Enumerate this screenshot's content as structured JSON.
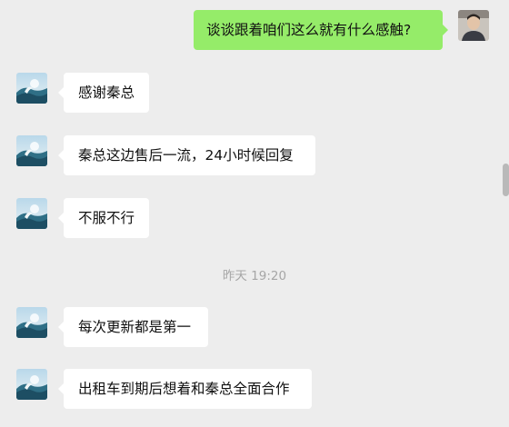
{
  "chat": {
    "sent": {
      "text": "谈谈跟着咱们这么就有什么感触?",
      "avatar_icon": "user-photo-avatar"
    },
    "received": [
      {
        "text": "感谢秦总",
        "avatar_icon": "ocean-wave-avatar"
      },
      {
        "text": "秦总这边售后一流，24小时候回复",
        "avatar_icon": "ocean-wave-avatar"
      },
      {
        "text": "不服不行",
        "avatar_icon": "ocean-wave-avatar"
      }
    ],
    "timestamp": "昨天 19:20",
    "received_after": [
      {
        "text": "每次更新都是第一",
        "avatar_icon": "ocean-wave-avatar"
      },
      {
        "text": "出租车到期后想着和秦总全面合作",
        "avatar_icon": "ocean-wave-avatar"
      }
    ]
  },
  "colors": {
    "background": "#ededed",
    "incoming_bubble": "#ffffff",
    "outgoing_bubble": "#95ec69",
    "timestamp_text": "#a6a6a6"
  }
}
